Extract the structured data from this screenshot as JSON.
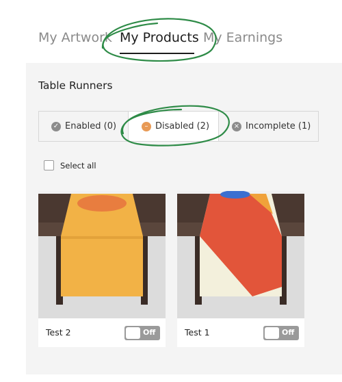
{
  "top_tabs": {
    "artwork": "My Artwork",
    "products": "My Products",
    "earnings": "My Earnings"
  },
  "section": {
    "title": "Table Runners"
  },
  "status_tabs": {
    "enabled": "Enabled (0)",
    "disabled": "Disabled (2)",
    "incomplete": "Incomplete (1)"
  },
  "select_all": "Select all",
  "products": [
    {
      "name": "Test 2",
      "toggle": "Off"
    },
    {
      "name": "Test 1",
      "toggle": "Off"
    }
  ],
  "colors": {
    "annotation": "#2e8b47",
    "panel_bg": "#f4f4f4",
    "toggle_off": "#9a9a9a",
    "runner_yellow": "#f2b246",
    "runner_red": "#e2553a"
  }
}
